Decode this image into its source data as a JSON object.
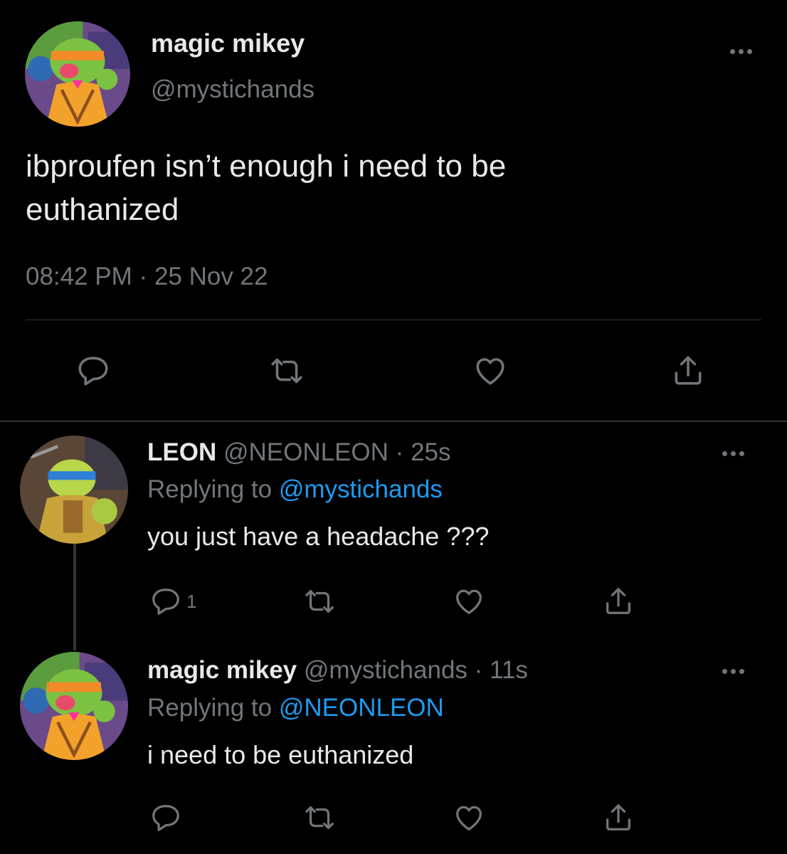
{
  "main_tweet": {
    "display_name": "magic mikey",
    "handle": "@mystichands",
    "text": "ibproufen isn’t enough i need to be euthanized",
    "time": "08:42 PM",
    "separator": "·",
    "date": "25 Nov 22"
  },
  "replies": [
    {
      "display_name": "LEON",
      "handle": "@NEONLEON",
      "separator": "·",
      "age": "25s",
      "replying_prefix": "Replying to",
      "replying_handle": "@mystichands",
      "text": "you just have a headache ???",
      "reply_count": "1"
    },
    {
      "display_name": "magic mikey",
      "handle": "@mystichands",
      "separator": "·",
      "age": "11s",
      "replying_prefix": "Replying to",
      "replying_handle": "@NEONLEON",
      "text": "i need to be euthanized",
      "reply_count": ""
    }
  ],
  "icons": {
    "reply": "reply-icon",
    "retweet": "retweet-icon",
    "like": "like-icon",
    "share": "share-icon",
    "more": "more-icon"
  },
  "colors": {
    "background": "#000000",
    "text": "#e7e9ea",
    "muted": "#71767b",
    "link": "#1d9bf0",
    "divider": "#2f3336",
    "thread_line": "#333639"
  }
}
